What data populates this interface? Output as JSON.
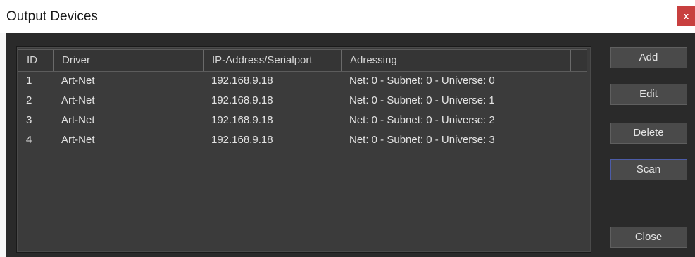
{
  "window": {
    "title": "Output Devices",
    "close_glyph": "x"
  },
  "table": {
    "columns": [
      "ID",
      "Driver",
      "IP-Address/Serialport",
      "Adressing"
    ],
    "rows": [
      [
        "1",
        "Art-Net",
        "192.168.9.18",
        "Net: 0 - Subnet: 0 - Universe: 0"
      ],
      [
        "2",
        "Art-Net",
        "192.168.9.18",
        "Net: 0 - Subnet: 0 - Universe: 1"
      ],
      [
        "3",
        "Art-Net",
        "192.168.9.18",
        "Net: 0 - Subnet: 0 - Universe: 2"
      ],
      [
        "4",
        "Art-Net",
        "192.168.9.18",
        "Net: 0 - Subnet: 0 - Universe: 3"
      ]
    ]
  },
  "buttons": {
    "add": "Add",
    "edit": "Edit",
    "delete": "Delete",
    "scan": "Scan",
    "close": "Close"
  },
  "colors": {
    "dialog_bg": "#2a2a2a",
    "list_bg": "#3b3b3b",
    "button_bg": "#4a4a4a",
    "close_red": "#c8403f",
    "focus_border": "#4c5ca8"
  }
}
